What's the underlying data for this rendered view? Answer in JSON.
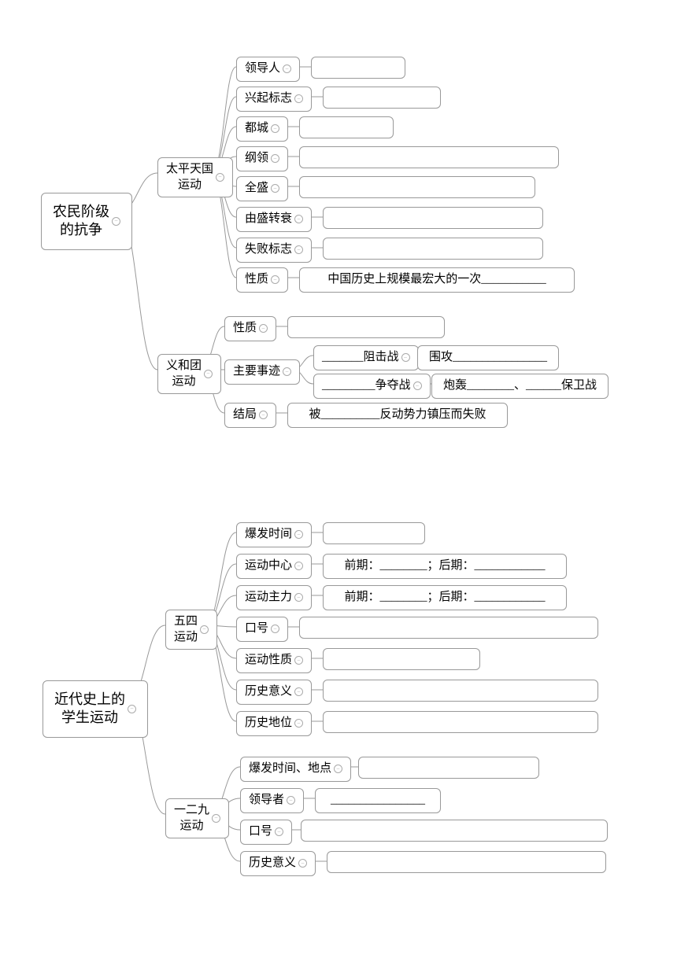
{
  "map1": {
    "root": "农民阶级\n的抗争",
    "branch1": {
      "title": "太平天国\n运动",
      "items": [
        "领导人",
        "兴起标志",
        "都城",
        "纲领",
        "全盛",
        "由盛转衰",
        "失败标志",
        "性质"
      ],
      "nature_text": "中国历史上规模最宏大的一次___________"
    },
    "branch2": {
      "title": "义和团\n运动",
      "items": [
        "性质",
        "主要事迹",
        "结局"
      ],
      "deeds": {
        "line1a": "_______阻击战",
        "line1b": "围攻________________",
        "line2a": "_________争夺战",
        "line2b": "炮轰________、______保卫战"
      },
      "ending": "被__________反动势力镇压而失败"
    }
  },
  "map2": {
    "root": "近代史上的\n学生运动",
    "branch1": {
      "title": "五四\n运动",
      "items": [
        "爆发时间",
        "运动中心",
        "运动主力",
        "口号",
        "运动性质",
        "历史意义",
        "历史地位"
      ],
      "center_text": "前期：________；后期：____________",
      "force_text": "前期：________；后期：____________"
    },
    "branch2": {
      "title": "一二九\n运动",
      "items": [
        "爆发时间、地点",
        "领导者",
        "口号",
        "历史意义"
      ],
      "leader_text": "________________"
    }
  }
}
